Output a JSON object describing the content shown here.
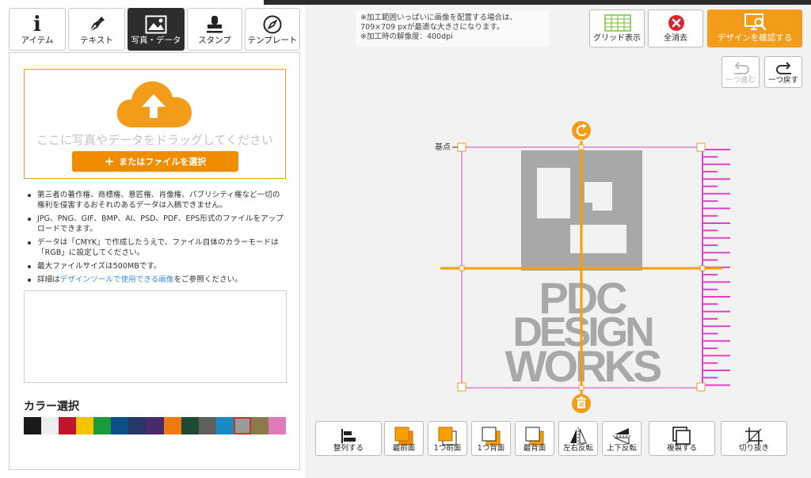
{
  "tabs": [
    {
      "label": "アイテム",
      "icon": "info-icon"
    },
    {
      "label": "テキスト",
      "icon": "pen-icon"
    },
    {
      "label": "写真・データ",
      "icon": "image-icon",
      "active": true
    },
    {
      "label": "スタンプ",
      "icon": "stamp-icon"
    },
    {
      "label": "テンプレート",
      "icon": "compass-icon"
    }
  ],
  "upload": {
    "drop_text": "ここに写真やデータをドラッグしてください",
    "file_button": "またはファイルを選択"
  },
  "notes": [
    "第三者の著作権、商標権、意匠権、肖像権、パブリシティ権など一切の権利を侵害するおそれのあるデータは入稿できません。",
    "JPG、PNG、GIF、BMP、AI、PSD、PDF、EPS形式のファイルをアップロードできます。",
    "データは「CMYK」で作成したうえで、ファイル自体のカラーモードは「RGB」に設定してください。",
    "最大ファイルサイズは500MBです。"
  ],
  "note_link": {
    "prefix": "詳細は",
    "link": "デザインツールで使用できる画像",
    "suffix": "をご参照ください。"
  },
  "color_section": {
    "title": "カラー選択",
    "swatches": [
      "#1a1a1a",
      "#eeeeee",
      "#c0152f",
      "#f5c400",
      "#1a9a3a",
      "#0a4f8a",
      "#253667",
      "#4a2a6a",
      "#f07a10",
      "#1f4a33",
      "#606060",
      "#1a8ac4",
      "#9a9a9a",
      "#8b7a4a",
      "#e07ab8"
    ],
    "selected_index": 12
  },
  "notice": [
    "※加工範囲いっぱいに画像を配置する場合は、",
    "709×709 pxが最適な大きさになります。",
    "※加工時の解像度：400dpi"
  ],
  "toolbar": {
    "grid_label": "グリッド表示",
    "clear_label": "全消去",
    "confirm_label": "デザインを確認する",
    "redo_label": "一つ進む",
    "undo_label": "一つ戻す"
  },
  "canvas": {
    "origin_label": "基点",
    "logo_lines": [
      "PDC",
      "DESIGN",
      "WORKS"
    ]
  },
  "bottom_toolbar": [
    {
      "label": "整列する",
      "icon": "align-icon"
    },
    {
      "label": "最前面",
      "icon": "bring-front-icon"
    },
    {
      "label": "1つ前面",
      "icon": "bring-forward-icon"
    },
    {
      "label": "1つ背面",
      "icon": "send-backward-icon"
    },
    {
      "label": "最背面",
      "icon": "send-back-icon"
    },
    {
      "label": "左右反転",
      "icon": "flip-horizontal-icon"
    },
    {
      "label": "上下反転",
      "icon": "flip-vertical-icon"
    },
    {
      "label": "複製する",
      "icon": "duplicate-icon"
    },
    {
      "label": "切り抜き",
      "icon": "crop-icon"
    }
  ],
  "colors": {
    "accent": "#f39c1a",
    "selection": "#e040c8",
    "guide": "#f5a000"
  }
}
